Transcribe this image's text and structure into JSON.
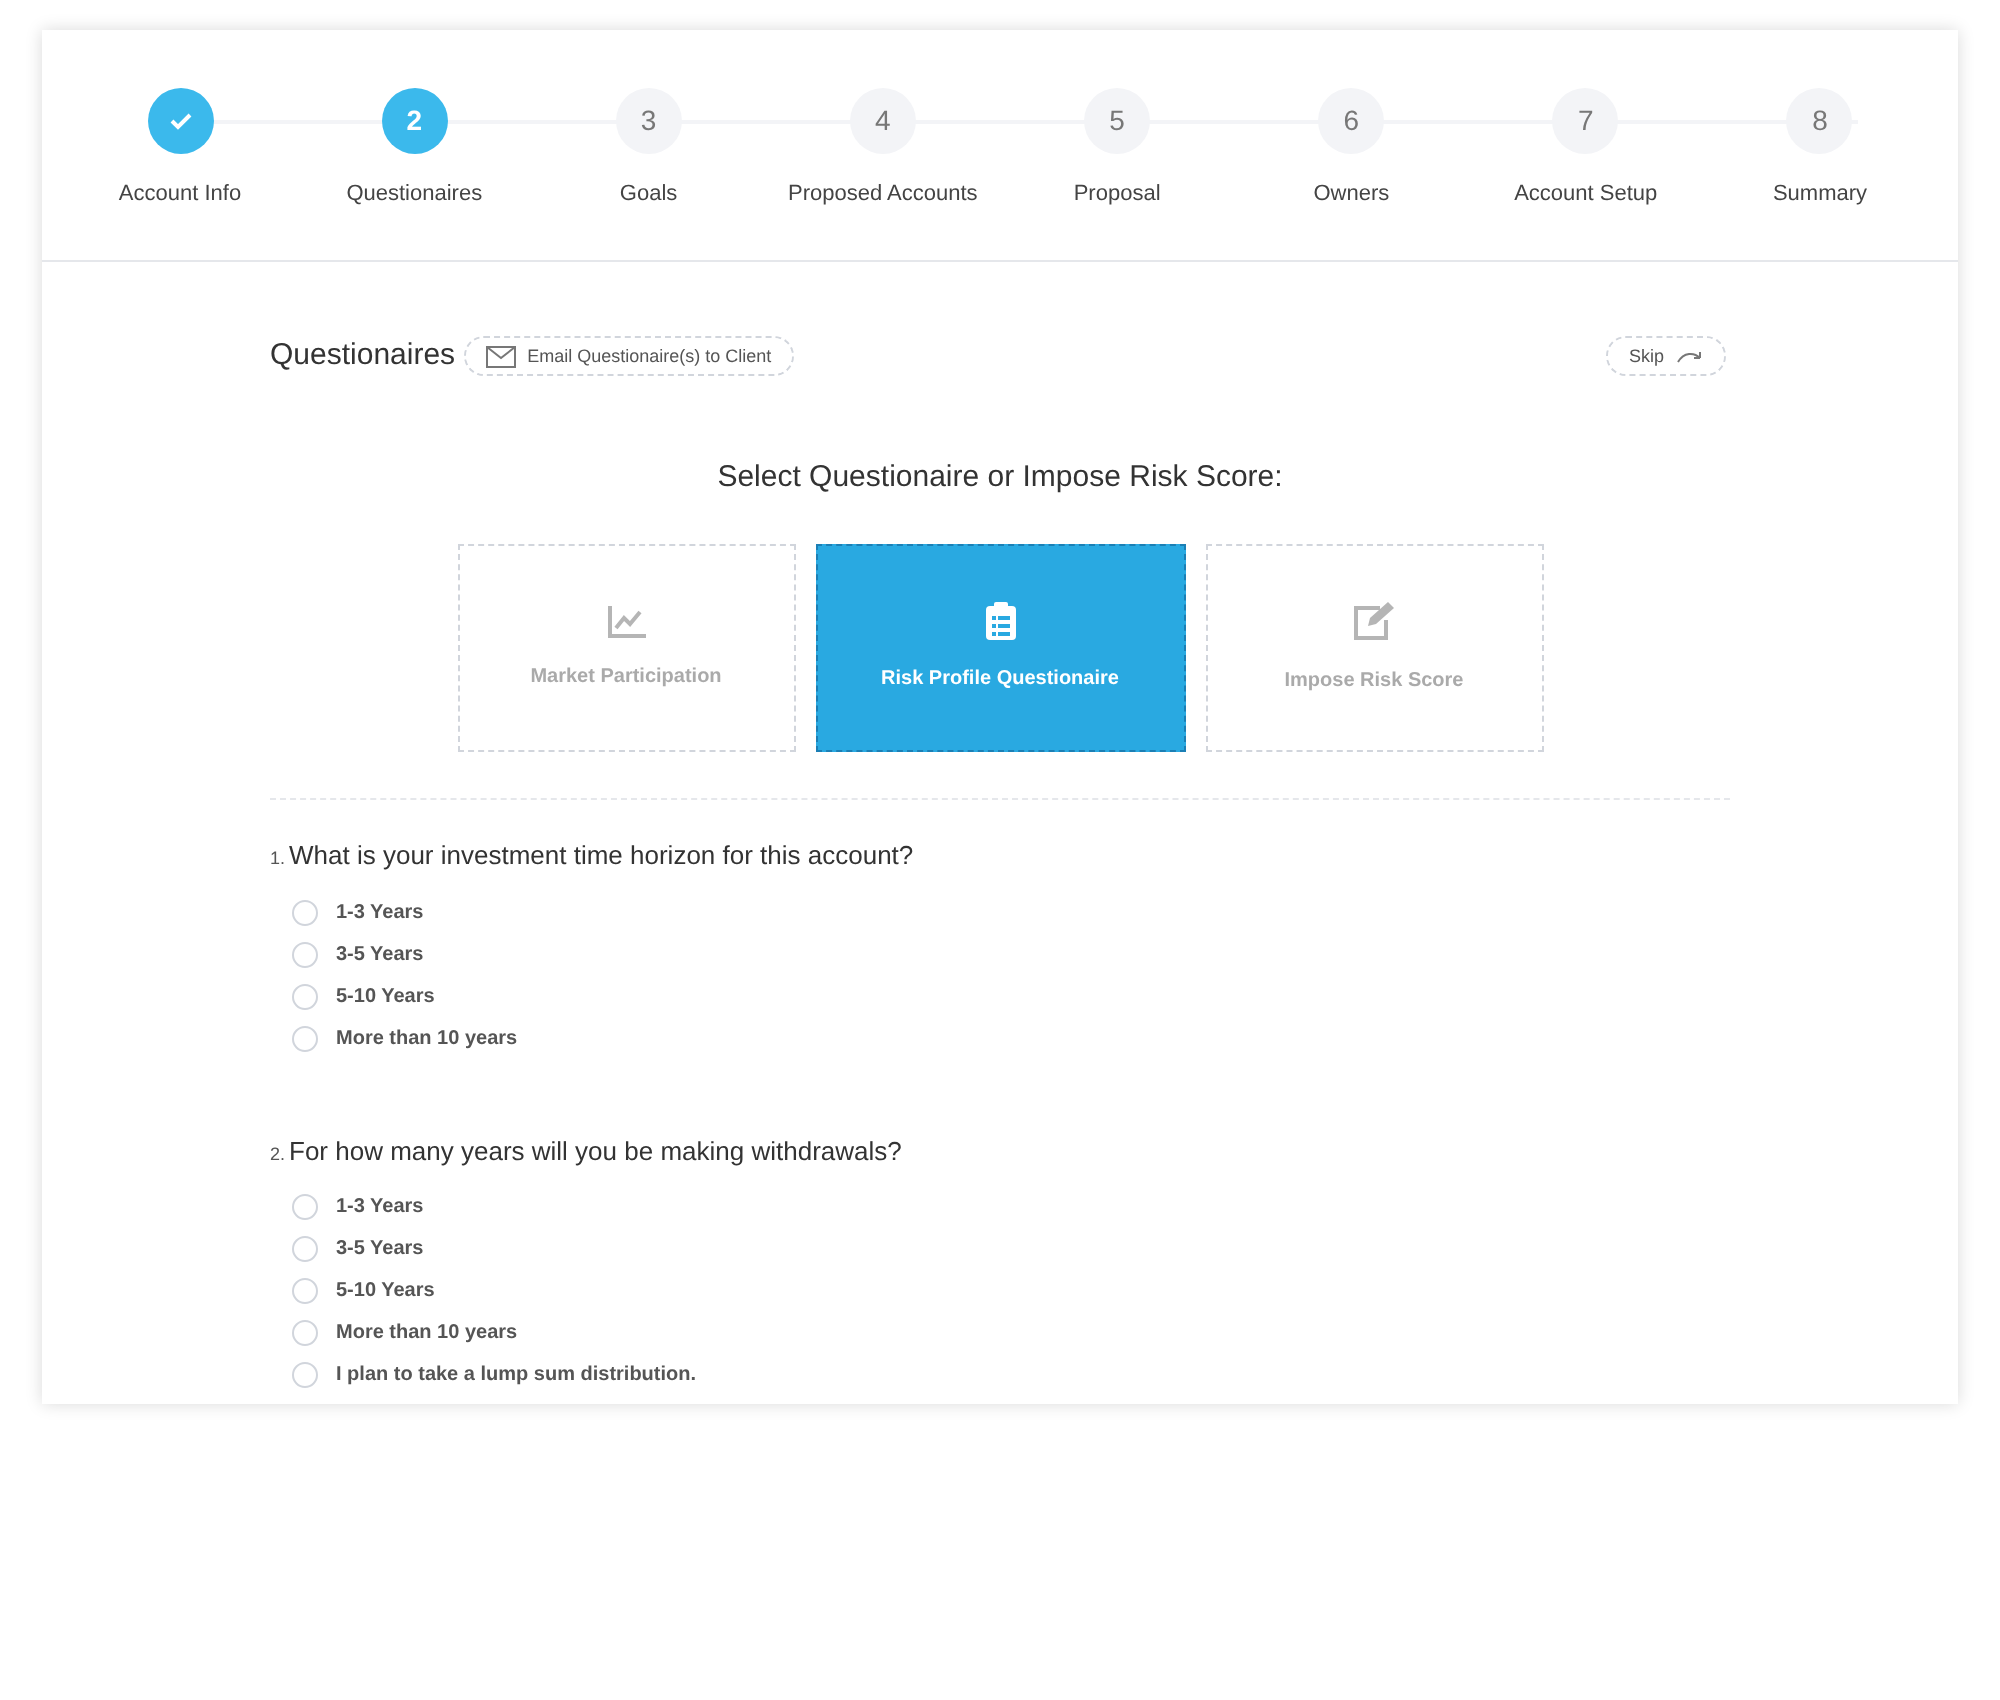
{
  "steps": [
    {
      "label": "Account Info",
      "completed": true,
      "selected": false
    },
    {
      "number": "2",
      "label": "Questionaires",
      "completed": false,
      "selected": true
    },
    {
      "number": "3",
      "label": "Goals",
      "completed": false,
      "selected": false
    },
    {
      "number": "4",
      "label": "Proposed Accounts",
      "completed": false,
      "selected": false
    },
    {
      "number": "5",
      "label": "Proposal",
      "completed": false,
      "selected": false
    },
    {
      "number": "6",
      "label": "Owners",
      "completed": false,
      "selected": false
    },
    {
      "number": "7",
      "label": "Account Setup",
      "completed": false,
      "selected": false
    },
    {
      "number": "8",
      "label": "Summary",
      "completed": false,
      "selected": false
    }
  ],
  "section_title": "Questionaires",
  "email_button": "Email Questionaire(s) to Client",
  "skip_button": "Skip",
  "select_prompt": "Select Questionaire or Impose Risk Score:",
  "choices": [
    {
      "kind": "chart",
      "label": "Market Participation",
      "selected": false
    },
    {
      "kind": "clipboard",
      "label": "Risk Profile Questionaire",
      "selected": true
    },
    {
      "kind": "edit",
      "label": "Impose Risk Score",
      "selected": false
    }
  ],
  "questions": [
    {
      "number": "1.",
      "text": "What is your investment time horizon for this account?",
      "options": [
        {
          "label": "1-3 Years",
          "selected": false
        },
        {
          "label": "3-5 Years",
          "selected": false
        },
        {
          "label": "5-10 Years",
          "selected": false
        },
        {
          "label": "More than 10 years",
          "selected": false
        }
      ]
    },
    {
      "number": "2.",
      "text": "For how many years will you be making withdrawals?",
      "options": [
        {
          "label": "1-3 Years",
          "selected": false
        },
        {
          "label": "3-5 Years",
          "selected": false
        },
        {
          "label": "5-10 Years",
          "selected": false
        },
        {
          "label": "More than 10 years",
          "selected": false
        },
        {
          "label": "I plan to take a lump sum distribution.",
          "selected": false
        }
      ]
    }
  ]
}
